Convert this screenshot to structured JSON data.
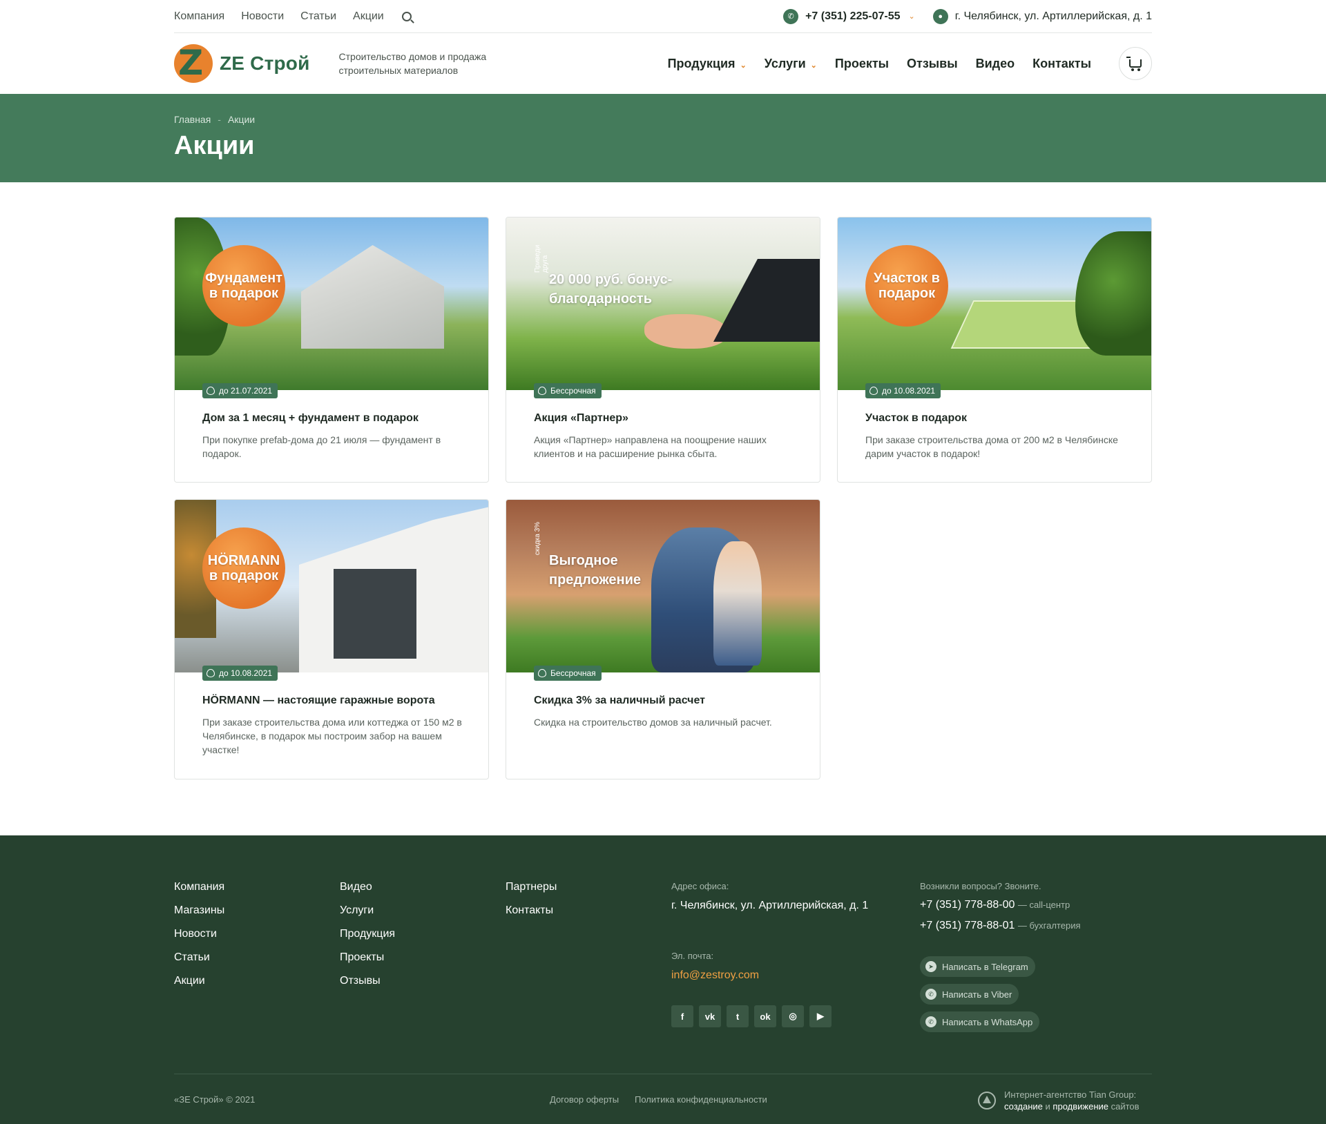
{
  "topbar": {
    "links": [
      "Компания",
      "Новости",
      "Статьи",
      "Акции"
    ],
    "phone": "+7 (351) 225-07-55",
    "address": "г. Челябинск, ул. Артиллерийская, д. 1"
  },
  "header": {
    "logo": "ZE Строй",
    "tagline": "Строительство домов и продажа строительных материалов",
    "nav": [
      "Продукция",
      "Услуги",
      "Проекты",
      "Отзывы",
      "Видео",
      "Контакты"
    ]
  },
  "breadcrumbs": [
    "Главная",
    "Акции"
  ],
  "page_title": "Акции",
  "promos": [
    {
      "badge": "до 21.07.2021",
      "title": "Дом за 1 месяц + фундамент в подарок",
      "desc": "При покупке prefab-дома до 21 июля — фундамент в подарок.",
      "overlay": "Фундамент в подарок"
    },
    {
      "badge": "Бессрочная",
      "title": "Акция «Партнер»",
      "desc": "Акция «Партнер» направлена на поощрение наших клиентов и на расширение рынка сбыта.",
      "overlay": "20 000 руб. бонус-благодарность",
      "side": "Приведи друга"
    },
    {
      "badge": "до 10.08.2021",
      "title": "Участок в подарок",
      "desc": "При заказе строительства дома от 200 м2 в Челябинске дарим участок в подарок!",
      "overlay": "Участок в подарок"
    },
    {
      "badge": "до 10.08.2021",
      "title": "HÖRMANN — настоящие гаражные ворота",
      "desc": "При заказе строительства дома или коттеджа от 150 м2 в Челябинске, в подарок мы построим забор на вашем участке!",
      "overlay": "HÖRMANN в подарок"
    },
    {
      "badge": "Бессрочная",
      "title": "Скидка 3% за наличный расчет",
      "desc": "Скидка на строительство домов за наличный расчет.",
      "overlay": "Выгодное предложение",
      "side": "скидка 3%"
    }
  ],
  "footer": {
    "col1": [
      "Компания",
      "Магазины",
      "Новости",
      "Статьи",
      "Акции"
    ],
    "col2": [
      "Видео",
      "Услуги",
      "Продукция",
      "Проекты",
      "Отзывы"
    ],
    "col3": [
      "Партнеры",
      "Контакты"
    ],
    "address_label": "Адрес офиса:",
    "address": "г. Челябинск, ул. Артиллерийская, д. 1",
    "email_label": "Эл. почта:",
    "email": "info@zestroy.com",
    "questions": "Возникли вопросы? Звоните.",
    "phone1": "+7 (351) 778-88-00",
    "phone1_note": "— call-центр",
    "phone2": "+7 (351) 778-88-01",
    "phone2_note": "— бухгалтерия",
    "telegram": "Написать в Telegram",
    "viber": "Написать в Viber",
    "whatsapp": "Написать в WhatsApp",
    "copyright": "«ЗЕ Строй» © 2021",
    "offer": "Договор оферты",
    "privacy": "Политика конфиденциальности",
    "agency1": "Интернет-агентство Tian Group:",
    "agency2a": "создание",
    "agency2b": "и",
    "agency2c": "продвижение",
    "agency2d": "сайтов"
  },
  "colors": {
    "brand_green": "#447b5b",
    "accent_orange": "#e8822d",
    "footer": "#26412f"
  }
}
